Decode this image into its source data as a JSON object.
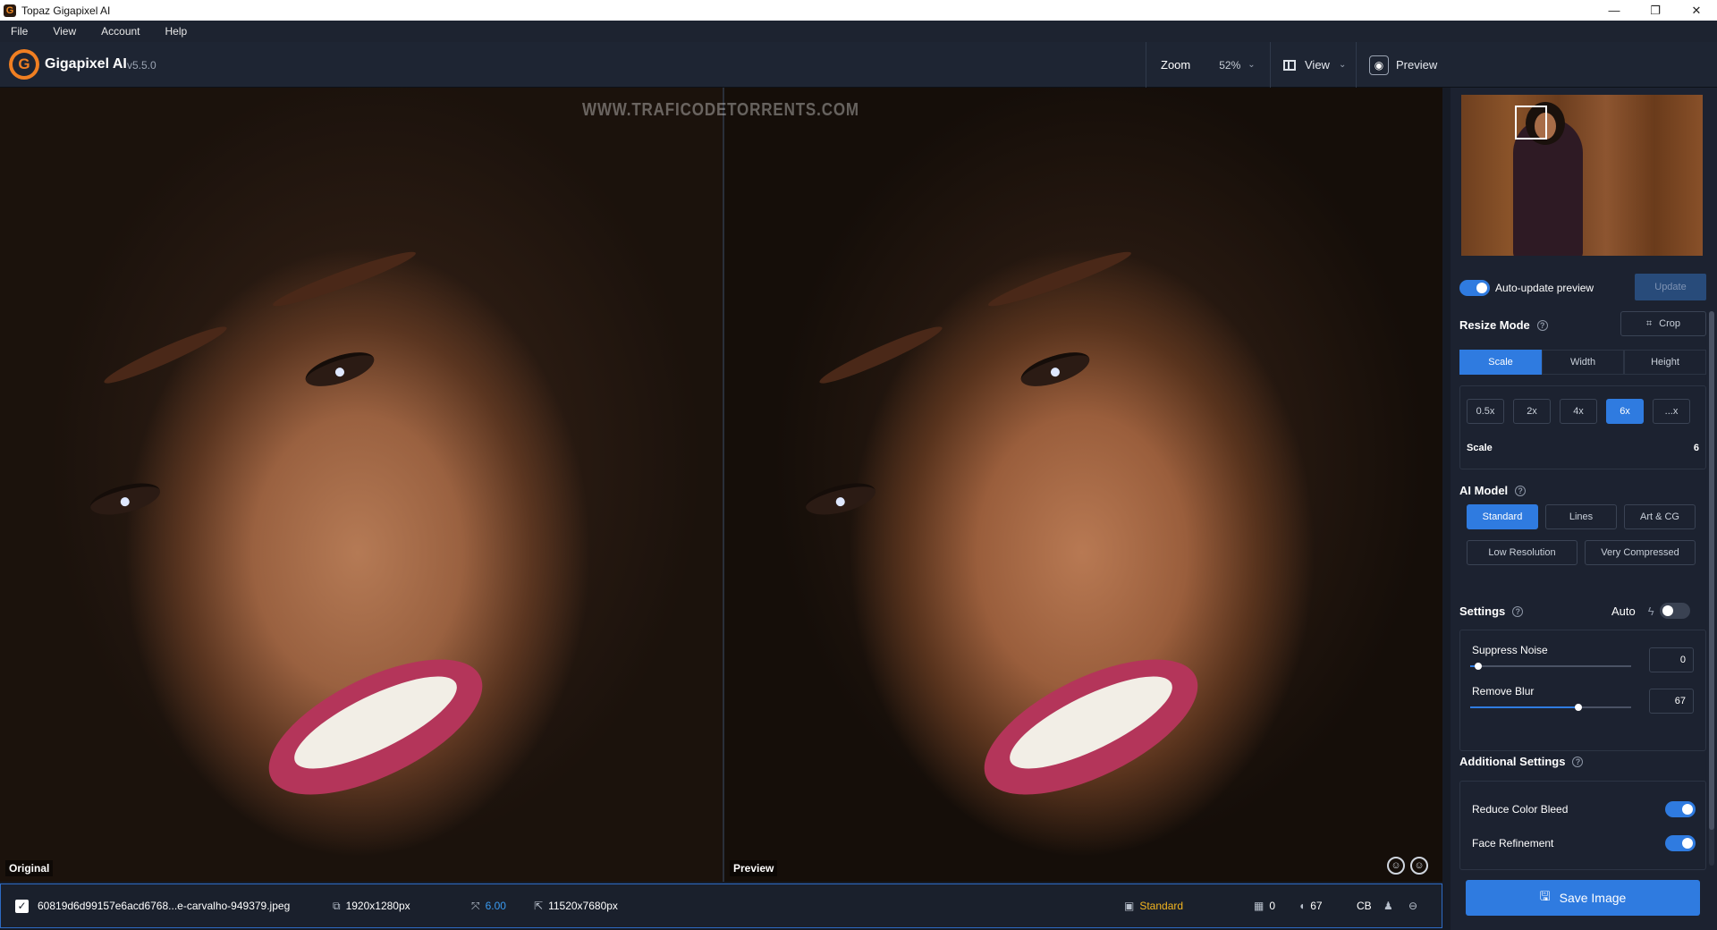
{
  "window": {
    "title": "Topaz Gigapixel AI",
    "minimize": "—",
    "maximize": "❐",
    "close": "✕"
  },
  "menu": [
    "File",
    "View",
    "Account",
    "Help"
  ],
  "toolbar": {
    "app_name": "Gigapixel AI",
    "version": "v5.5.0",
    "zoom_label": "Zoom",
    "zoom_value": "52%",
    "view_label": "View",
    "preview_label": "Preview"
  },
  "canvas": {
    "watermark": "WWW.TRAFICODETORRENTS.COM",
    "left_label": "Original",
    "right_label": "Preview"
  },
  "statusbar": {
    "filename": "60819d6d99157e6acd6768...e-carvalho-949379.jpeg",
    "input_size": "1920x1280px",
    "scale": "6.00",
    "output_size": "11520x7680px",
    "model": "Standard",
    "noise": "0",
    "blur": "67",
    "format": "CB"
  },
  "sidebar": {
    "auto_update_label": "Auto-update preview",
    "update_button": "Update",
    "resize_mode": {
      "title": "Resize Mode",
      "crop": "Crop",
      "tabs": [
        "Scale",
        "Width",
        "Height"
      ],
      "active_tab": "Scale"
    },
    "scale_options": [
      "0.5x",
      "2x",
      "4x",
      "6x",
      "...x"
    ],
    "active_scale": "6x",
    "scale_label": "Scale",
    "scale_value": "6",
    "ai_model": {
      "title": "AI Model",
      "models": [
        "Standard",
        "Lines",
        "Art & CG",
        "Low Resolution",
        "Very Compressed"
      ],
      "active": "Standard"
    },
    "settings": {
      "title": "Settings",
      "auto_label": "Auto",
      "auto_on": false
    },
    "suppress_noise": {
      "label": "Suppress Noise",
      "value": "0",
      "level": 0.05
    },
    "remove_blur": {
      "label": "Remove Blur",
      "value": "67",
      "level": 0.67
    },
    "additional": {
      "title": "Additional Settings",
      "reduce_color_bleed": "Reduce Color Bleed",
      "face_refinement": "Face Refinement"
    },
    "save_button": "Save Image"
  },
  "colors": {
    "accent": "#2f7be0",
    "brand": "#f07f22",
    "model_badge": "#f3b51f",
    "scale_text": "#3a9af0"
  }
}
